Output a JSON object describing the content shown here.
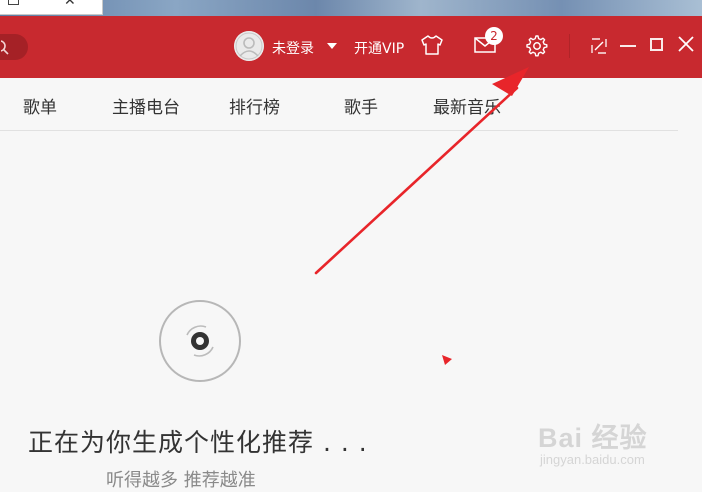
{
  "titlebar": {
    "login_label": "未登录",
    "vip_label": "开通VIP",
    "mail_count": "2",
    "accent": "#c8292f"
  },
  "nav": {
    "items": [
      {
        "label": "歌单"
      },
      {
        "label": "主播电台"
      },
      {
        "label": "排行榜"
      },
      {
        "label": "歌手"
      },
      {
        "label": "最新音乐"
      }
    ]
  },
  "main": {
    "status_text": "正在为你生成个性化推荐 . . .",
    "status_sub": "听得越多 推荐越准"
  },
  "icons": [
    "search-icon",
    "avatar-icon",
    "dropdown-arrow-icon",
    "skin-icon",
    "mail-icon",
    "settings-icon",
    "mini-mode-icon",
    "minimize-icon",
    "maximize-icon",
    "close-icon",
    "disc-icon"
  ],
  "annotation": {
    "arrow_color": "#e8252a"
  },
  "watermark": {
    "main": "Bai 经验",
    "sub": "jingyan.baidu.com"
  }
}
